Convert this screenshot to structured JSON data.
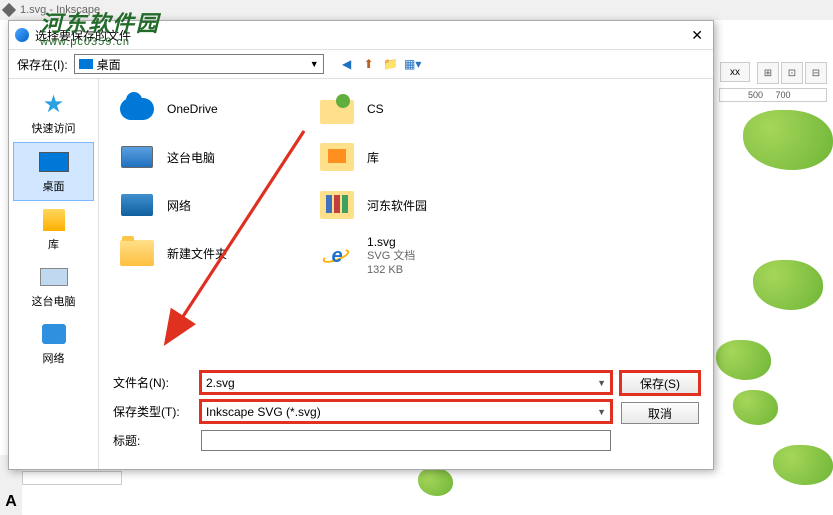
{
  "app": {
    "title": "1.svg - Inkscape"
  },
  "watermark": {
    "cn": "河东软件园",
    "url": "www.pc0359.cn"
  },
  "toolbar_right": {
    "xx": "xx",
    "r1": "500",
    "r2": "700"
  },
  "dialog": {
    "title": "选择要保存的文件",
    "close": "✕",
    "save_in_label": "保存在(I):",
    "save_in_value": "桌面",
    "places": {
      "quick": "快速访问",
      "desktop": "桌面",
      "libs": "库",
      "thispc": "这台电脑",
      "network": "网络"
    },
    "files_left": [
      {
        "name": "OneDrive",
        "ico": "cloud"
      },
      {
        "name": "这台电脑",
        "ico": "monitor"
      },
      {
        "name": "网络",
        "ico": "globe-mon"
      },
      {
        "name": "新建文件夹",
        "ico": "folder"
      }
    ],
    "files_right": [
      {
        "name": "CS",
        "ico": "person-folder"
      },
      {
        "name": "库",
        "ico": "lib-folder"
      },
      {
        "name": "河东软件园",
        "ico": "books"
      },
      {
        "name": "1.svg",
        "ico": "ie",
        "meta1": "SVG 文档",
        "meta2": "132 KB"
      }
    ],
    "filename_label": "文件名(N):",
    "filename_value": "2.svg",
    "filetype_label": "保存类型(T):",
    "filetype_value": "Inkscape SVG (*.svg)",
    "title_label": "标题:",
    "title_value": "",
    "save_btn": "保存(S)",
    "cancel_btn": "取消"
  },
  "left_tool": "A"
}
